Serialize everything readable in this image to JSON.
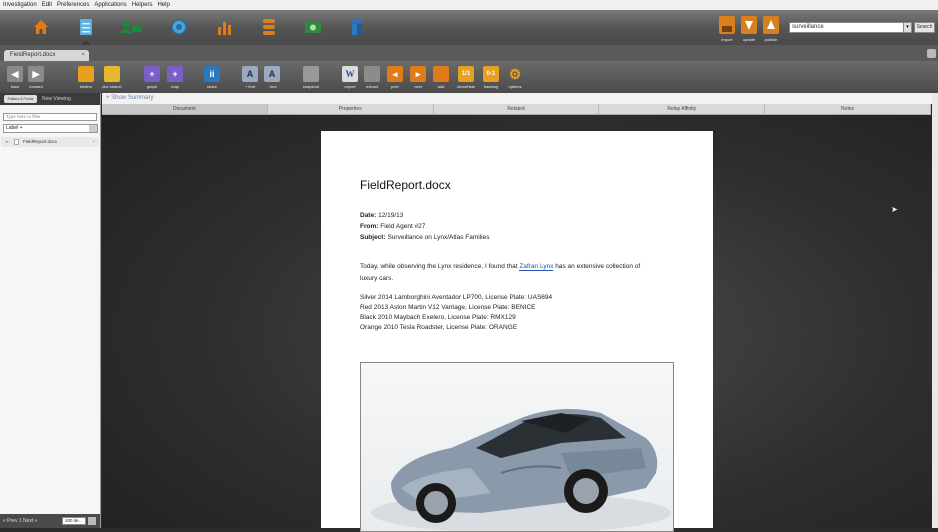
{
  "menu": [
    "Investigation",
    "Edit",
    "Preferences",
    "Applications",
    "Helpers",
    "Help"
  ],
  "app_icons": [
    {
      "name": "home-icon",
      "color": "#e07b1a"
    },
    {
      "name": "document-icon",
      "color": "#5ab2e0"
    },
    {
      "name": "person-card-icon",
      "color": "#1b8a3a"
    },
    {
      "name": "globe-icon",
      "color": "#4ba3d6"
    },
    {
      "name": "bar-chart-icon",
      "color": "#e07b1a"
    },
    {
      "name": "database-icon",
      "color": "#d8801e"
    },
    {
      "name": "camera-icon",
      "color": "#2e8a3a"
    },
    {
      "name": "people-icon",
      "color": "#2a77c2"
    }
  ],
  "top_right": {
    "import": "import",
    "update": "update",
    "publish": "publish"
  },
  "search": {
    "value": "surveillance",
    "button": "Search"
  },
  "doc_tab": {
    "label": "FieldReport.docx",
    "close": "×"
  },
  "toolbar": [
    {
      "name": "back",
      "label": "back",
      "color": "#777"
    },
    {
      "name": "forward",
      "label": "forward",
      "color": "#777"
    },
    {
      "name": "folders",
      "label": "folders",
      "color": "#e8a020"
    },
    {
      "name": "doc-search",
      "label": "doc search",
      "color": "#e8b830"
    },
    {
      "name": "graph",
      "label": "graph",
      "color": "#7b5fc9"
    },
    {
      "name": "map",
      "label": "map",
      "color": "#7b5fc9"
    },
    {
      "name": "share",
      "label": "share",
      "color": "#2a77c2"
    },
    {
      "name": "font-up",
      "label": "+ font",
      "color": "#4b7fc2"
    },
    {
      "name": "font-down",
      "label": "- font",
      "color": "#4b7fc2"
    },
    {
      "name": "snapshot",
      "label": "snapshot",
      "color": "#888"
    },
    {
      "name": "export",
      "label": "export",
      "color": "#dcdcdc",
      "glyph": "W"
    },
    {
      "name": "extract",
      "label": "extract",
      "color": "#888"
    },
    {
      "name": "prev",
      "label": "prev",
      "color": "#e07b1a"
    },
    {
      "name": "next",
      "label": "next",
      "color": "#e07b1a"
    },
    {
      "name": "add",
      "label": "add",
      "color": "#e07b1a"
    },
    {
      "name": "show-hide",
      "label": "show/hide",
      "color": "#e8a020",
      "glyph": "1/1"
    },
    {
      "name": "flashtag",
      "label": "flashtag",
      "color": "#e8a020",
      "glyph": "0-1"
    },
    {
      "name": "options",
      "label": "options",
      "color": "#e8a020"
    }
  ],
  "left_panel": {
    "tab1": "Folders & Forms",
    "tab2": "Now Viewing",
    "filter_placeholder": "Type here to filter",
    "select": "Label +",
    "item": "FieldReport.docx",
    "pager": "« Prev 1 Next »",
    "page_size": "100 ite..."
  },
  "summary_link": "+ Show Summary",
  "subtabs": [
    "Document",
    "Properties",
    "Related",
    "Relay Affinity",
    "Notes"
  ],
  "document": {
    "title": "FieldReport.docx",
    "date_label": "Date:",
    "date": "12/19/13",
    "from_label": "From:",
    "from": "Field Agent #27",
    "subject_label": "Subject:",
    "subject": "Surveillance on Lynx/Atlas Families",
    "para_1a": "Today, while observing the Lynx residence, I found that ",
    "para_link": "Zafran Lynx",
    "para_1b": " has an extensive collection of",
    "para_2": "luxury cars.",
    "cars": [
      "Silver 2014 Lamborghini Aventador LP700, License Plate: UAS694",
      "Red 2013 Aston Martin V12 Vantage, License Plate: BENICE",
      "Black 2010 Maybach Exelero, License Plate: RMX129",
      "Orange 2010 Tesla Roadster, License Plate: ORANGE"
    ]
  }
}
